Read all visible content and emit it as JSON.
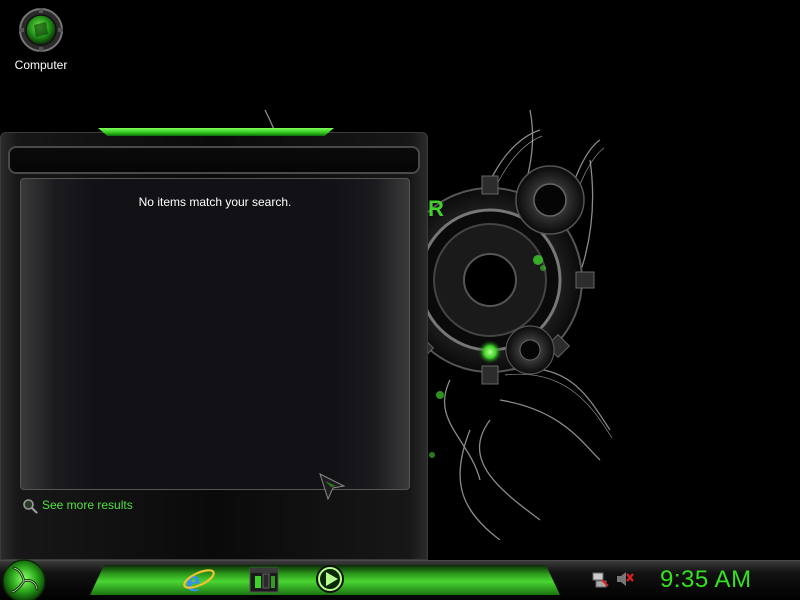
{
  "desktop": {
    "icons": [
      {
        "label": "Computer",
        "icon": "computer-icon"
      }
    ]
  },
  "start_menu": {
    "search_value": "",
    "no_results_text": "No items match your search.",
    "see_more_label": "See more results"
  },
  "taskbar": {
    "start_icon": "razer-start-orb-icon",
    "pinned": [
      {
        "icon": "internet-explorer-icon"
      },
      {
        "icon": "razer-app-icon"
      },
      {
        "icon": "media-player-icon"
      }
    ],
    "tray": [
      {
        "icon": "network-disconnected-icon"
      },
      {
        "icon": "volume-muted-icon"
      }
    ],
    "clock": "9:35 AM"
  },
  "colors": {
    "accent": "#35e21f",
    "background": "#000000",
    "link": "#52e040"
  }
}
